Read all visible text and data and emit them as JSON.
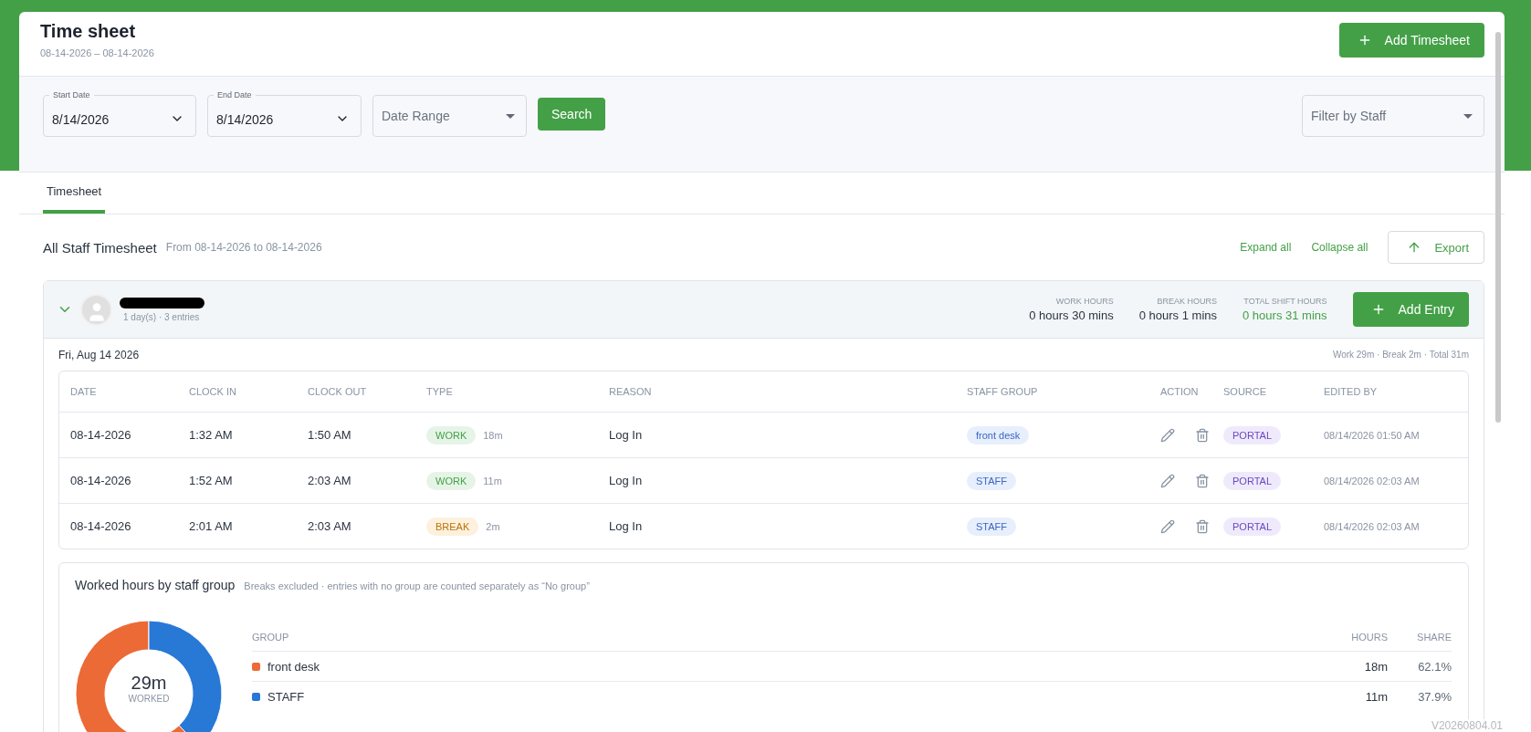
{
  "header": {
    "title": "Time sheet",
    "date_range": "08-14-2026 – 08-14-2026",
    "add_button": "Add Timesheet"
  },
  "filters": {
    "start_date": {
      "label": "Start Date",
      "value": "8/14/2026"
    },
    "end_date": {
      "label": "End Date",
      "value": "8/14/2026"
    },
    "date_range": {
      "placeholder": "Date Range"
    },
    "search_button": "Search",
    "staff_filter": {
      "placeholder": "Filter by Staff"
    }
  },
  "tabs": [
    {
      "label": "Timesheet",
      "selected": true
    }
  ],
  "section": {
    "title": "All Staff Timesheet",
    "subtitle": "From 08-14-2026 to 08-14-2026",
    "expand_all": "Expand all",
    "collapse_all": "Collapse all",
    "export_button": "Export"
  },
  "staff": {
    "expanded": true,
    "meta": "1 day(s) · 3 entries",
    "add_entry_button": "Add Entry",
    "stats": [
      {
        "label": "WORK HOURS",
        "value": "0 hours 30 mins",
        "highlight": false
      },
      {
        "label": "BREAK HOURS",
        "value": "0 hours 1 mins",
        "highlight": false
      },
      {
        "label": "TOTAL SHIFT HOURS",
        "value": "0 hours 31 mins",
        "highlight": true
      }
    ]
  },
  "day": {
    "label": "Fri, Aug 14 2026",
    "summary": "Work 29m · Break 2m · Total 31m"
  },
  "table": {
    "columns": [
      "DATE",
      "CLOCK IN",
      "CLOCK OUT",
      "TYPE",
      "REASON",
      "STAFF GROUP",
      "ACTION",
      "SOURCE",
      "EDITED BY"
    ],
    "rows": [
      {
        "date": "08-14-2026",
        "clock_in": "1:32 AM",
        "clock_out": "1:50 AM",
        "type": {
          "label": "WORK",
          "kind": "work"
        },
        "duration": "18m",
        "reason": "Log In",
        "staff_group": "front desk",
        "source": "PORTAL",
        "edited_by": "08/14/2026 01:50 AM"
      },
      {
        "date": "08-14-2026",
        "clock_in": "1:52 AM",
        "clock_out": "2:03 AM",
        "type": {
          "label": "WORK",
          "kind": "work"
        },
        "duration": "11m",
        "reason": "Log In",
        "staff_group": "STAFF",
        "source": "PORTAL",
        "edited_by": "08/14/2026 02:03 AM"
      },
      {
        "date": "08-14-2026",
        "clock_in": "2:01 AM",
        "clock_out": "2:03 AM",
        "type": {
          "label": "BREAK",
          "kind": "break"
        },
        "duration": "2m",
        "reason": "Log In",
        "staff_group": "STAFF",
        "source": "PORTAL",
        "edited_by": "08/14/2026 02:03 AM"
      }
    ]
  },
  "group_chart": {
    "title": "Worked hours by staff group",
    "note": "Breaks excluded · entries with no group are counted separately as “No group”",
    "center_value": "29m",
    "center_label": "WORKED",
    "columns": [
      "GROUP",
      "HOURS",
      "SHARE"
    ],
    "rows": [
      {
        "name": "front desk",
        "color": "#ec6a35",
        "hours": "18m",
        "share": "62.1%"
      },
      {
        "name": "STAFF",
        "color": "#2878d6",
        "hours": "11m",
        "share": "37.9%"
      }
    ]
  },
  "version": "V20260804.01"
}
